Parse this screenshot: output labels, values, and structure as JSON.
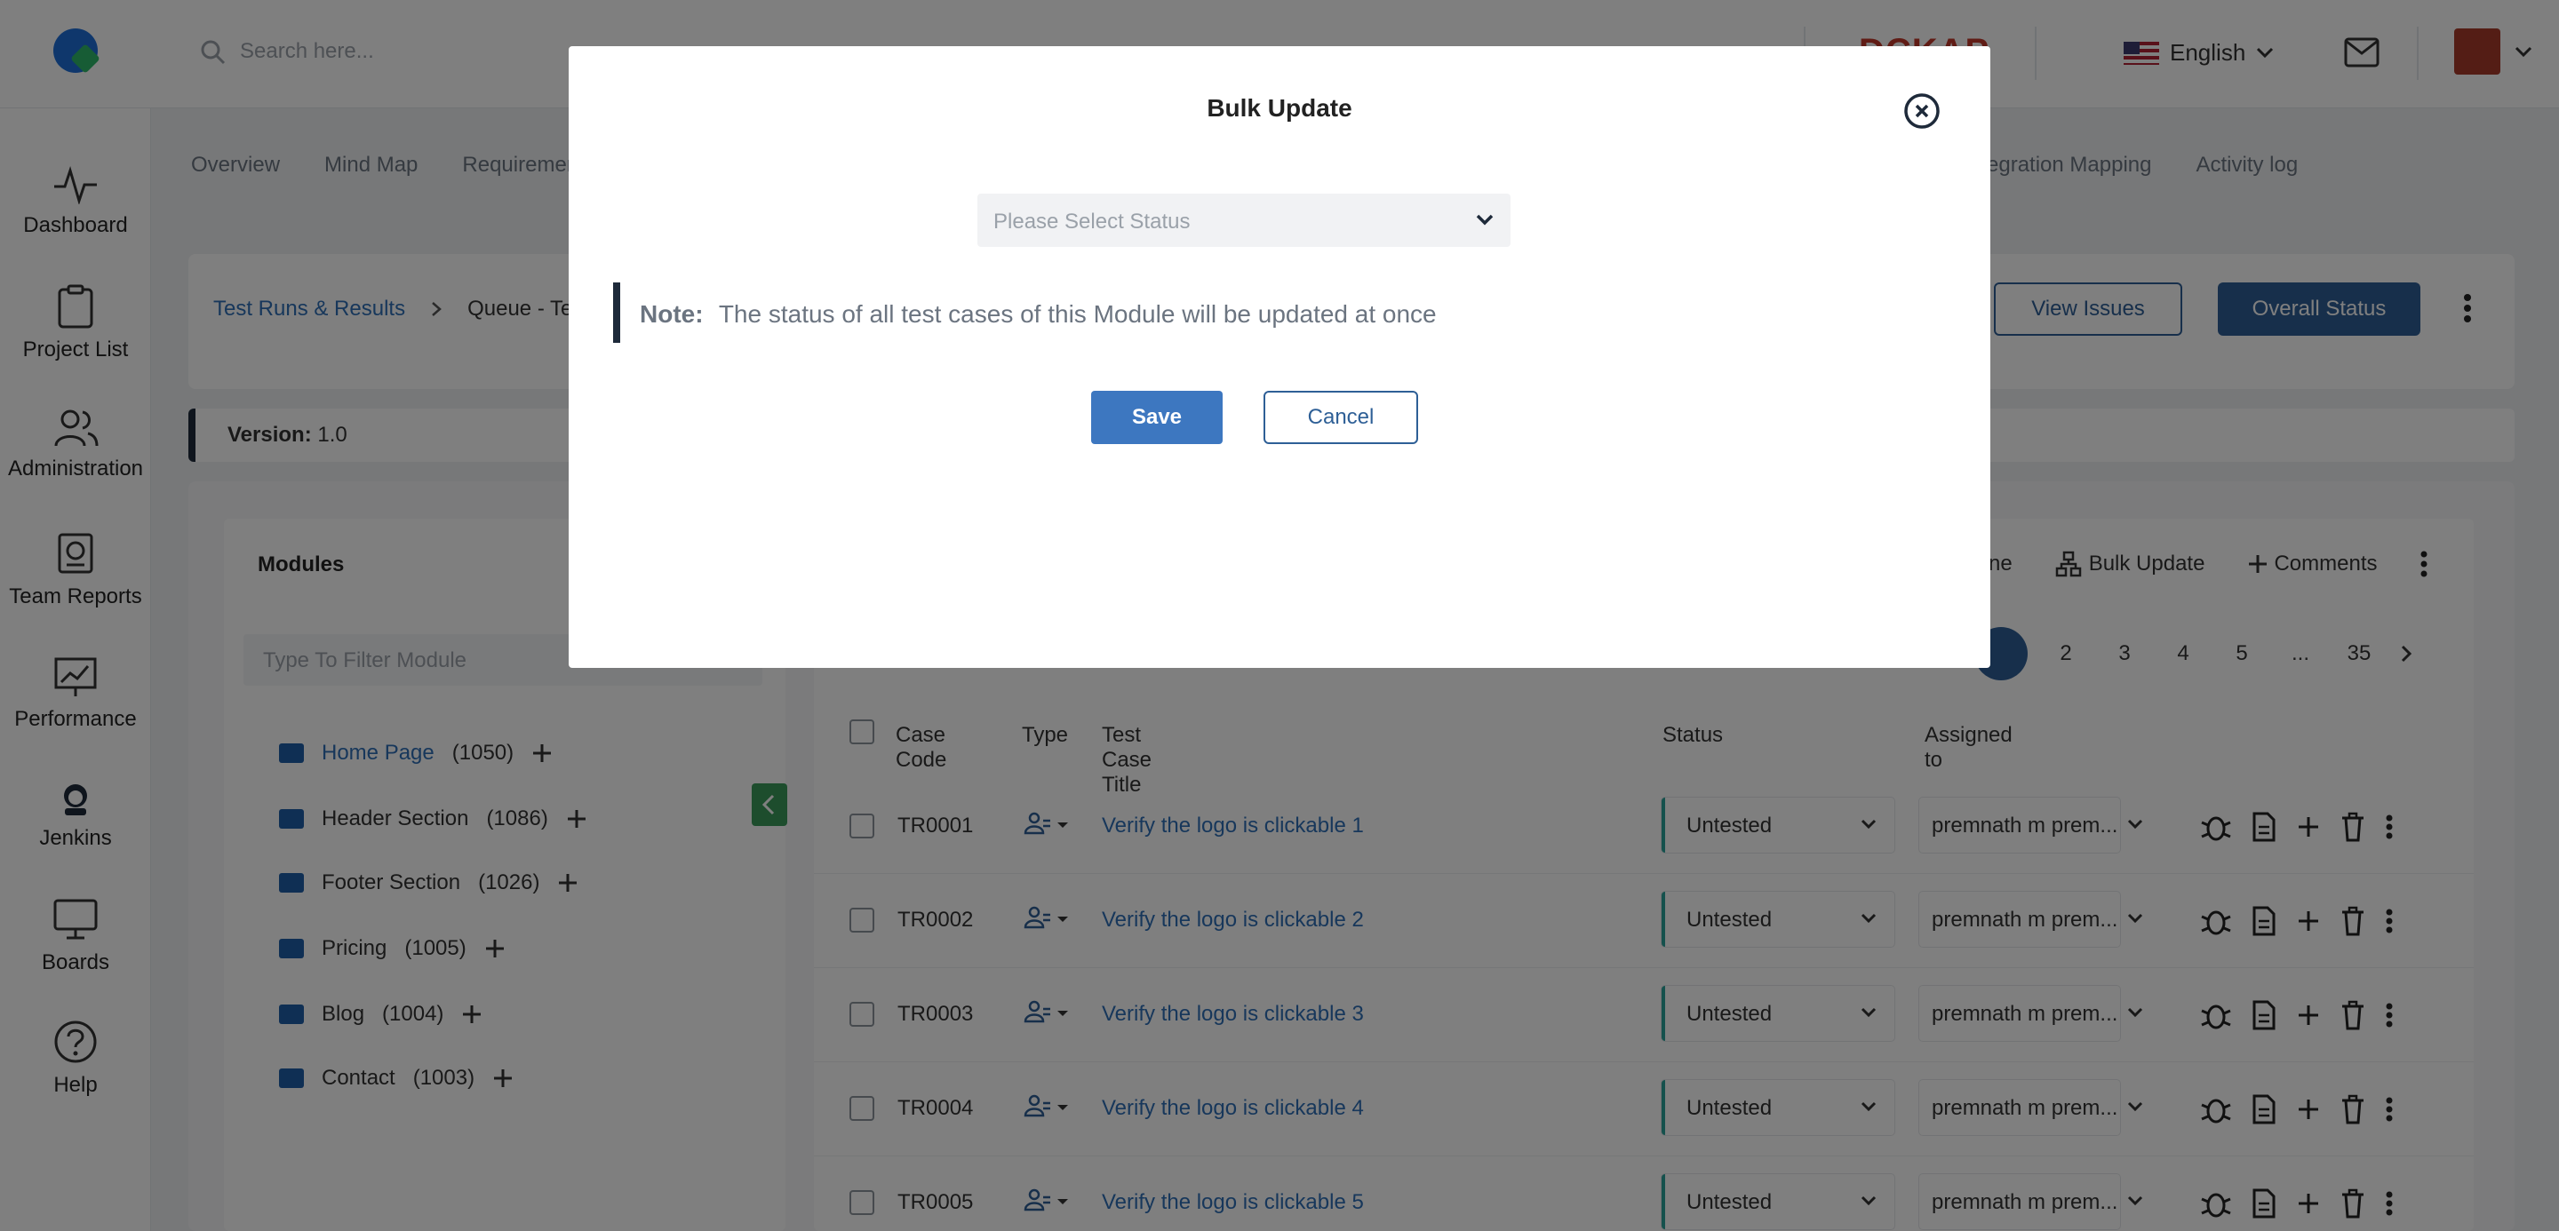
{
  "search": {
    "placeholder": "Search here..."
  },
  "brand": {
    "text": "DCKAP"
  },
  "language": {
    "label": "English"
  },
  "sidebar": {
    "items": [
      {
        "label": "Dashboard"
      },
      {
        "label": "Project List"
      },
      {
        "label": "Administration"
      },
      {
        "label": "Team Reports"
      },
      {
        "label": "Performance"
      },
      {
        "label": "Jenkins"
      },
      {
        "label": "Boards"
      },
      {
        "label": "Help"
      }
    ]
  },
  "tabs": {
    "left": [
      "Overview",
      "Mind Map",
      "Requiremen"
    ],
    "right": [
      "ntegration Mapping",
      "Activity log"
    ]
  },
  "breadcrumb": {
    "root": "Test Runs & Results",
    "current": "Queue - Tes"
  },
  "header_buttons": {
    "view_issues": "View Issues",
    "overall_status": "Overall Status"
  },
  "version": {
    "label": "Version:",
    "value": "1.0"
  },
  "modules": {
    "title": "Modules",
    "filter_placeholder": "Type To Filter Module",
    "items": [
      {
        "name": "Home Page",
        "count": "(1050)"
      },
      {
        "name": "Header Section",
        "count": "(1086)"
      },
      {
        "name": "Footer Section",
        "count": "(1026)"
      },
      {
        "name": "Pricing",
        "count": "(1005)"
      },
      {
        "name": "Blog",
        "count": "(1004)"
      },
      {
        "name": "Contact",
        "count": "(1003)"
      }
    ]
  },
  "toolbar": {
    "clone_partial": "ne",
    "bulk_update": "Bulk Update",
    "comments": "Comments"
  },
  "pagination": {
    "pages": [
      "2",
      "3",
      "4",
      "5",
      "...",
      "35"
    ]
  },
  "table": {
    "headers": {
      "code": "Case Code",
      "type": "Type",
      "title": "Test Case Title",
      "status": "Status",
      "assigned": "Assigned to"
    },
    "rows": [
      {
        "code": "TR0001",
        "title": "Verify the logo is clickable 1",
        "status": "Untested",
        "assigned": "premnath m prem..."
      },
      {
        "code": "TR0002",
        "title": "Verify the logo is clickable 2",
        "status": "Untested",
        "assigned": "premnath m prem..."
      },
      {
        "code": "TR0003",
        "title": "Verify the logo is clickable 3",
        "status": "Untested",
        "assigned": "premnath m prem..."
      },
      {
        "code": "TR0004",
        "title": "Verify the logo is clickable 4",
        "status": "Untested",
        "assigned": "premnath m prem..."
      },
      {
        "code": "TR0005",
        "title": "Verify the logo is clickable 5",
        "status": "Untested",
        "assigned": "premnath m prem..."
      }
    ]
  },
  "modal": {
    "title": "Bulk Update",
    "status_placeholder": "Please Select Status",
    "note_label": "Note:",
    "note_text": "The status of all test cases of this Module will be updated at once",
    "save": "Save",
    "cancel": "Cancel"
  },
  "colors": {
    "primary": "#2e5f96",
    "link": "#2e6fb7",
    "status_accent": "#2ba39b",
    "save": "#3d77c0"
  }
}
